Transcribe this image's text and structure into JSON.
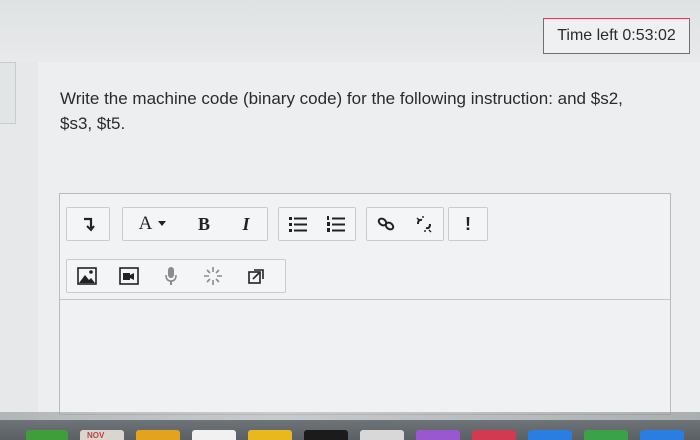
{
  "header": {
    "timer_text": "Time left 0:53:02"
  },
  "question": {
    "text_line1": "Write the machine code (binary code) for the following instruction:  and $s2,",
    "text_line2": "$s3, $t5."
  },
  "editor": {
    "toolbar": {
      "font_menu_label": "A",
      "bold_label": "B",
      "italic_label": "I",
      "special_label": "!"
    }
  },
  "dock": {
    "calendar_month": "NOV"
  },
  "colors": {
    "timer_border": "#c9475a",
    "page_bg": "#e6e8e9",
    "editor_bg": "#f1f2f3"
  }
}
